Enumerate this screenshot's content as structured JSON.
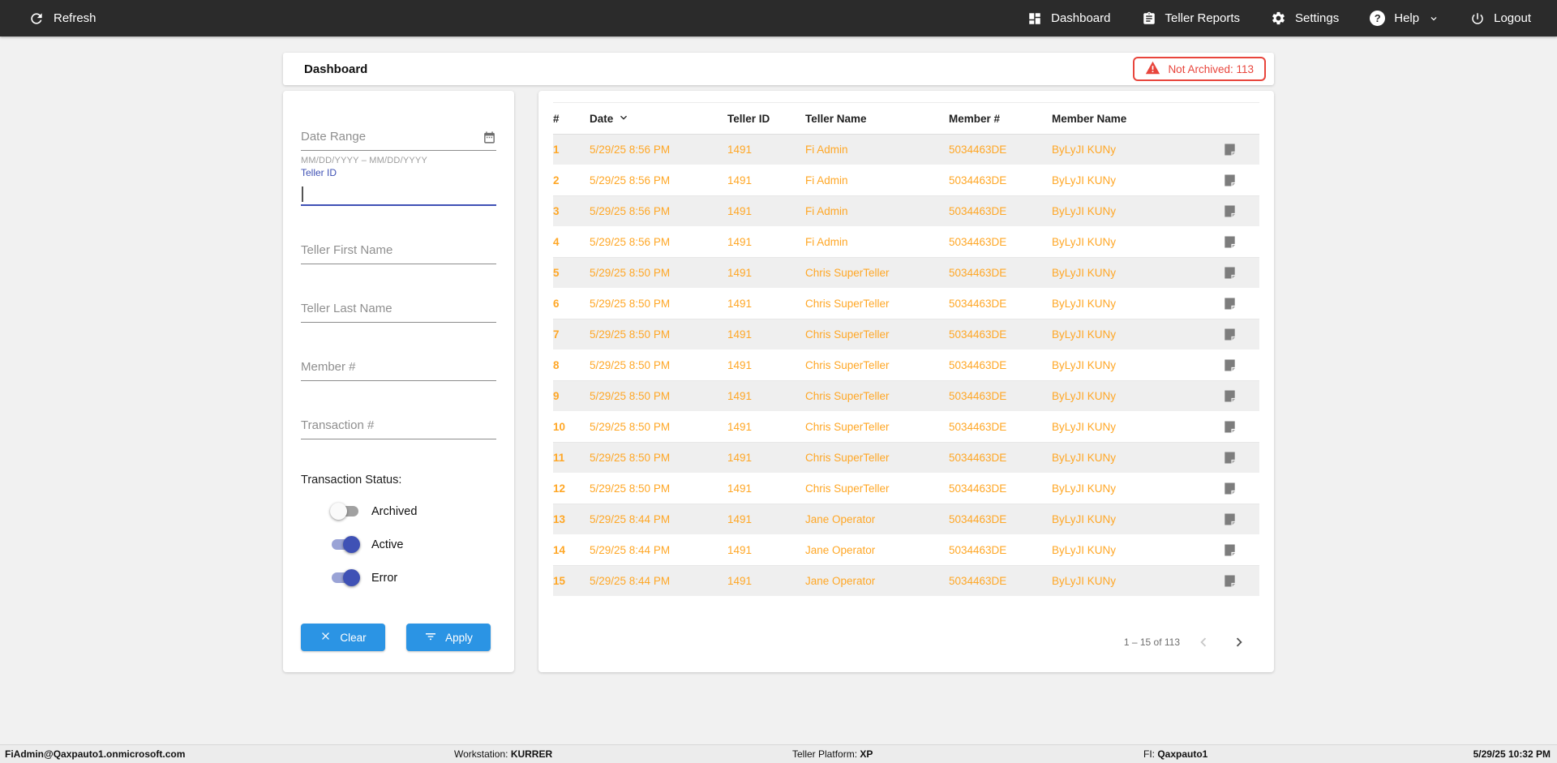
{
  "topnav": {
    "refresh_label": "Refresh",
    "items": [
      {
        "label": "Dashboard",
        "icon": "dashboard-icon"
      },
      {
        "label": "Teller Reports",
        "icon": "clipboard-icon"
      },
      {
        "label": "Settings",
        "icon": "gear-icon"
      },
      {
        "label": "Help",
        "icon": "help-icon",
        "has_dropdown": true
      },
      {
        "label": "Logout",
        "icon": "power-icon"
      }
    ]
  },
  "header": {
    "title": "Dashboard",
    "alert_badge": "Not Archived: 113"
  },
  "filters": {
    "date_range": {
      "placeholder": "Date Range",
      "value": "",
      "hint": "MM/DD/YYYY – MM/DD/YYYY"
    },
    "teller_id": {
      "label": "Teller ID",
      "value": ""
    },
    "teller_first_name": {
      "placeholder": "Teller First Name",
      "value": ""
    },
    "teller_last_name": {
      "placeholder": "Teller Last Name",
      "value": ""
    },
    "member_number": {
      "placeholder": "Member #",
      "value": ""
    },
    "transaction_number": {
      "placeholder": "Transaction #",
      "value": ""
    },
    "status_label": "Transaction Status:",
    "toggles": [
      {
        "label": "Archived",
        "on": false
      },
      {
        "label": "Active",
        "on": true
      },
      {
        "label": "Error",
        "on": true
      }
    ],
    "clear_label": "Clear",
    "apply_label": "Apply"
  },
  "table": {
    "columns": [
      "#",
      "Date",
      "Teller ID",
      "Teller Name",
      "Member #",
      "Member Name"
    ],
    "sort": {
      "column": "Date",
      "direction": "desc"
    },
    "rows": [
      {
        "num": "1",
        "date": "5/29/25 8:56 PM",
        "teller_id": "1491",
        "teller_name": "Fi Admin",
        "member_number": "5034463DE",
        "member_name": "ByLyJI KUNy"
      },
      {
        "num": "2",
        "date": "5/29/25 8:56 PM",
        "teller_id": "1491",
        "teller_name": "Fi Admin",
        "member_number": "5034463DE",
        "member_name": "ByLyJI KUNy"
      },
      {
        "num": "3",
        "date": "5/29/25 8:56 PM",
        "teller_id": "1491",
        "teller_name": "Fi Admin",
        "member_number": "5034463DE",
        "member_name": "ByLyJI KUNy"
      },
      {
        "num": "4",
        "date": "5/29/25 8:56 PM",
        "teller_id": "1491",
        "teller_name": "Fi Admin",
        "member_number": "5034463DE",
        "member_name": "ByLyJI KUNy"
      },
      {
        "num": "5",
        "date": "5/29/25 8:50 PM",
        "teller_id": "1491",
        "teller_name": "Chris SuperTeller",
        "member_number": "5034463DE",
        "member_name": "ByLyJI KUNy"
      },
      {
        "num": "6",
        "date": "5/29/25 8:50 PM",
        "teller_id": "1491",
        "teller_name": "Chris SuperTeller",
        "member_number": "5034463DE",
        "member_name": "ByLyJI KUNy"
      },
      {
        "num": "7",
        "date": "5/29/25 8:50 PM",
        "teller_id": "1491",
        "teller_name": "Chris SuperTeller",
        "member_number": "5034463DE",
        "member_name": "ByLyJI KUNy"
      },
      {
        "num": "8",
        "date": "5/29/25 8:50 PM",
        "teller_id": "1491",
        "teller_name": "Chris SuperTeller",
        "member_number": "5034463DE",
        "member_name": "ByLyJI KUNy"
      },
      {
        "num": "9",
        "date": "5/29/25 8:50 PM",
        "teller_id": "1491",
        "teller_name": "Chris SuperTeller",
        "member_number": "5034463DE",
        "member_name": "ByLyJI KUNy"
      },
      {
        "num": "10",
        "date": "5/29/25 8:50 PM",
        "teller_id": "1491",
        "teller_name": "Chris SuperTeller",
        "member_number": "5034463DE",
        "member_name": "ByLyJI KUNy"
      },
      {
        "num": "11",
        "date": "5/29/25 8:50 PM",
        "teller_id": "1491",
        "teller_name": "Chris SuperTeller",
        "member_number": "5034463DE",
        "member_name": "ByLyJI KUNy"
      },
      {
        "num": "12",
        "date": "5/29/25 8:50 PM",
        "teller_id": "1491",
        "teller_name": "Chris SuperTeller",
        "member_number": "5034463DE",
        "member_name": "ByLyJI KUNy"
      },
      {
        "num": "13",
        "date": "5/29/25 8:44 PM",
        "teller_id": "1491",
        "teller_name": "Jane Operator",
        "member_number": "5034463DE",
        "member_name": "ByLyJI KUNy"
      },
      {
        "num": "14",
        "date": "5/29/25 8:44 PM",
        "teller_id": "1491",
        "teller_name": "Jane Operator",
        "member_number": "5034463DE",
        "member_name": "ByLyJI KUNy"
      },
      {
        "num": "15",
        "date": "5/29/25 8:44 PM",
        "teller_id": "1491",
        "teller_name": "Jane Operator",
        "member_number": "5034463DE",
        "member_name": "ByLyJI KUNy"
      }
    ],
    "pagination": {
      "range_label": "1 – 15 of 113",
      "prev_enabled": false,
      "next_enabled": true
    }
  },
  "statusbar": {
    "user": "FiAdmin@Qaxpauto1.onmicrosoft.com",
    "workstation_label": "Workstation:",
    "workstation": "KURRER",
    "platform_label": "Teller Platform:",
    "platform": "XP",
    "fi_label": "FI:",
    "fi": "Qaxpauto1",
    "datetime": "5/29/25 10:32 PM"
  },
  "colors": {
    "navbar_bg": "#2b2b2b",
    "accent_blue": "#2b94e4",
    "toggle_indigo": "#3f51b5",
    "row_text_orange": "#ffa726",
    "alert_red": "#e8453c",
    "row_alt_bg": "#efefef"
  }
}
